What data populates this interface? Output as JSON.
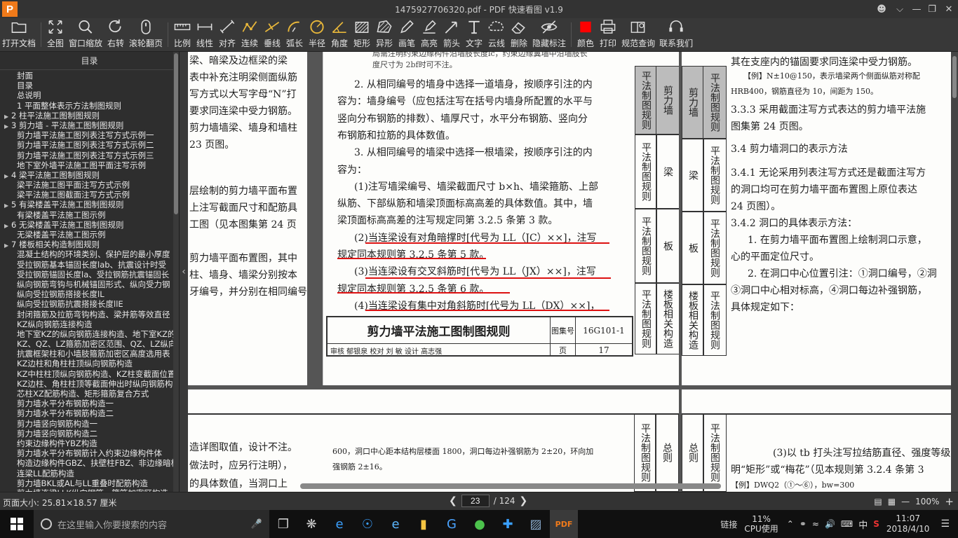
{
  "window": {
    "title": "1475927706320.pdf - PDF 快速看图 v1.9",
    "logo": "P"
  },
  "toolbar": [
    {
      "label": "打开文档",
      "icon": "folder-icon"
    },
    {
      "label": "全图",
      "icon": "fit-all-icon"
    },
    {
      "label": "窗口缩放",
      "icon": "zoom-window-icon"
    },
    {
      "label": "右转",
      "icon": "rotate-right-icon"
    },
    {
      "label": "滚轮翻页",
      "icon": "mouse-wheel-icon"
    },
    {
      "label": "比例",
      "icon": "ruler-icon"
    },
    {
      "label": "线性",
      "icon": "linear-measure-icon"
    },
    {
      "label": "对齐",
      "icon": "aligned-measure-icon"
    },
    {
      "label": "连续",
      "icon": "continuous-measure-icon"
    },
    {
      "label": "垂线",
      "icon": "perpendicular-icon"
    },
    {
      "label": "弧长",
      "icon": "arc-length-icon"
    },
    {
      "label": "半径",
      "icon": "radius-icon"
    },
    {
      "label": "角度",
      "icon": "angle-icon"
    },
    {
      "label": "矩形",
      "icon": "rectangle-area-icon"
    },
    {
      "label": "异形",
      "icon": "irregular-area-icon"
    },
    {
      "label": "画笔",
      "icon": "pen-icon"
    },
    {
      "label": "高亮",
      "icon": "highlight-icon"
    },
    {
      "label": "箭头",
      "icon": "arrow-icon"
    },
    {
      "label": "文字",
      "icon": "text-icon"
    },
    {
      "label": "云线",
      "icon": "cloud-line-icon"
    },
    {
      "label": "删除",
      "icon": "eraser-icon"
    },
    {
      "label": "隐藏标注",
      "icon": "hide-annotation-icon"
    },
    {
      "label": "颜色",
      "icon": "color-swatch-icon"
    },
    {
      "label": "打印",
      "icon": "printer-icon"
    },
    {
      "label": "规范查询",
      "icon": "book-search-icon"
    },
    {
      "label": "联系我们",
      "icon": "headset-icon"
    }
  ],
  "colors": {
    "accent": "#e8b73a",
    "swatch": "#ff0000",
    "annotation": "#d11111",
    "logo": "#f07a1a"
  },
  "outline": {
    "header": "目录",
    "items": [
      {
        "label": "封面",
        "level": 0,
        "toggle": ""
      },
      {
        "label": "目录",
        "level": 0,
        "toggle": ""
      },
      {
        "label": "总说明",
        "level": 0,
        "toggle": ""
      },
      {
        "label": "1 平面整体表示方法制图规则",
        "level": 0,
        "toggle": ""
      },
      {
        "label": "2 柱平法施工图制图规则",
        "level": 0,
        "toggle": "▶"
      },
      {
        "label": "3 剪力墙 - 平法施工图制图规则",
        "level": 0,
        "toggle": "▶"
      },
      {
        "label": "剪力墙平法施工图列表注写方式示例一",
        "level": 1,
        "toggle": ""
      },
      {
        "label": "剪力墙平法施工图列表注写方式示例二",
        "level": 1,
        "toggle": ""
      },
      {
        "label": "剪力墙平法施工图列表注写方式示例三",
        "level": 1,
        "toggle": ""
      },
      {
        "label": "地下室外墙平法施工图平面注写示例",
        "level": 1,
        "toggle": ""
      },
      {
        "label": "4 梁平法施工图制图规则",
        "level": 0,
        "toggle": "▶"
      },
      {
        "label": "梁平法施工图平面注写方式示例",
        "level": 1,
        "toggle": ""
      },
      {
        "label": "梁平法施工图截面注写方式示例",
        "level": 1,
        "toggle": ""
      },
      {
        "label": "5 有梁楼盖平法施工图制图规则",
        "level": 0,
        "toggle": "▶"
      },
      {
        "label": "有梁楼盖平法施工图示例",
        "level": 1,
        "toggle": ""
      },
      {
        "label": "6 无梁楼盖平法施工图制图规则",
        "level": 0,
        "toggle": "▶"
      },
      {
        "label": "无梁楼盖平法施工图示例",
        "level": 1,
        "toggle": ""
      },
      {
        "label": "7 楼板相关构造制图规则",
        "level": 0,
        "toggle": "▶"
      },
      {
        "label": "混凝土结构的环境类别、保护层的最小厚度",
        "level": 0,
        "toggle": ""
      },
      {
        "label": "受拉钢筋基本锚固长度lab、抗震设计时受",
        "level": 0,
        "toggle": ""
      },
      {
        "label": "受拉钢筋锚固长度la、受拉钢筋抗震锚固长",
        "level": 0,
        "toggle": ""
      },
      {
        "label": "纵向钢筋弯钩与机械锚固形式、纵向受力钢",
        "level": 0,
        "toggle": ""
      },
      {
        "label": "纵向受拉钢筋搭接长度lL",
        "level": 0,
        "toggle": ""
      },
      {
        "label": "纵向受拉钢筋抗震搭接长度llE",
        "level": 0,
        "toggle": ""
      },
      {
        "label": "封闭箍筋及拉筋弯钩构造、梁并筋等效直径",
        "level": 0,
        "toggle": ""
      },
      {
        "label": "KZ纵向钢筋连接构造",
        "level": 0,
        "toggle": ""
      },
      {
        "label": "地下室KZ的纵向钢筋连接构造、地下室KZ的",
        "level": 0,
        "toggle": ""
      },
      {
        "label": "KZ、QZ、LZ箍筋加密区范围、QZ、LZ纵向钢",
        "level": 0,
        "toggle": ""
      },
      {
        "label": "抗震框架柱和小墙肢箍筋加密区高度选用表",
        "level": 0,
        "toggle": ""
      },
      {
        "label": "KZ边柱和角柱柱顶纵向钢筋构造",
        "level": 0,
        "toggle": ""
      },
      {
        "label": "KZ中柱柱顶纵向钢筋构造、KZ柱变截面位置",
        "level": 0,
        "toggle": ""
      },
      {
        "label": "KZ边柱、角柱柱顶等截面伸出时纵向钢筋构",
        "level": 0,
        "toggle": ""
      },
      {
        "label": "芯柱XZ配筋构造、矩形箍筋复合方式",
        "level": 0,
        "toggle": ""
      },
      {
        "label": "剪力墙水平分布钢筋构造一",
        "level": 0,
        "toggle": ""
      },
      {
        "label": "剪力墙水平分布钢筋构造二",
        "level": 0,
        "toggle": ""
      },
      {
        "label": "剪力墙竖向钢筋构造一",
        "level": 0,
        "toggle": ""
      },
      {
        "label": "剪力墙竖向钢筋构造二",
        "level": 0,
        "toggle": ""
      },
      {
        "label": "约束边缘构件YBZ构造",
        "level": 0,
        "toggle": ""
      },
      {
        "label": "剪力墙水平分布钢筋计入约束边缘构件体",
        "level": 0,
        "toggle": ""
      },
      {
        "label": "构造边缘构件GBZ、扶壁柱FBZ、非边缘暗柱",
        "level": 0,
        "toggle": ""
      },
      {
        "label": "连梁LL配筋构造",
        "level": 0,
        "toggle": ""
      },
      {
        "label": "剪力墙BKL或AL与LL重叠时配筋构造",
        "level": 0,
        "toggle": ""
      },
      {
        "label": "剪力墙连梁LLK纵向钢筋、箍筋加密区构造",
        "level": 0,
        "toggle": ""
      }
    ]
  },
  "page_left": {
    "lines": [
      "梁、暗梁及边框梁的梁",
      "表中补充注明梁侧面纵筋",
      "写方式以大写字母“N”打",
      "要求同连梁中受力钢筋。",
      "剪力墙墙梁、墙身和墙柱",
      "23 页图。",
      "层绘制的剪力墙平面布置",
      "上注写截面尺寸和配筋具",
      "工图（见本图集第 24 页",
      "剪力墙平面布置图，其中",
      "柱、墙身、墙梁分别按本",
      "牙编号，并分别在相同编号"
    ]
  },
  "page_main": {
    "top_note_1": "局需注明约束边缘构件沿墙肢长度lc，约束边缘翼墙中沿墙肢长",
    "top_note_2": "度尺寸为 2bf时可不注。",
    "lines": [
      "2. 从相同编号的墙身中选择一道墙身，按顺序引注的内",
      "容为：墙身编号（应包括注写在括号内墙身所配置的水平与",
      "竖向分布钢筋的排数）、墙厚尺寸，水平分布钢筋、竖向分",
      "布钢筋和拉筋的具体数值。",
      "3. 从相同编号的墙梁中选择一根墙梁，按顺序引注的内",
      "容为：",
      "(1)注写墙梁编号、墙梁截面尺寸 b×h、墙梁箍筋、上部",
      "纵筋、下部纵筋和墙梁顶面标高高差的具体数值。其中，墙",
      "梁顶面标高高差的注写规定同第 3.2.5 条第 3 款。",
      "(2)当连梁设有对角暗撑时[代号为 LL（JC）××]，注写",
      "规定同本规则第 3.2.5 条第 5 款。",
      "(3)当连梁设有交叉斜筋时[代号为 LL（JX）××]，注写",
      "规定同本规则第 3.2.5 条第 6 款。",
      "(4)当连梁设有集中对角斜筋时[代号为 LL（DX）××]，"
    ],
    "title_block": {
      "title": "剪力墙平法施工图制图规则",
      "atlas_label": "图集号",
      "atlas_no": "16G101-1",
      "row2": "审核 郁银泉 校对 刘 敏 设计 高志强",
      "page_label": "页",
      "page_no": "17"
    },
    "side_tabs": [
      "剪力墙",
      "平法制图规则",
      "梁",
      "平法制图规则",
      "板",
      "平法制图规则",
      "楼板相关构造",
      "平法制图规则"
    ]
  },
  "page_right": {
    "lines": [
      "其在支座内的锚固要求同连梁中受力钢筋。",
      "【例】N±10@150，表示墙梁两个侧面纵筋对称配",
      "HRB400，钢筋直径为 10，间距为 150。",
      "3.3.3 采用截面注写方式表达的剪力墙平法施",
      "图集第 24 页图。",
      "3.4 剪力墙洞口的表示方法",
      "3.4.1 无论采用列表注写方式还是截面注写方",
      "的洞口均可在剪力墙平面布置图上原位表达",
      "24 页图）。",
      "3.4.2 洞口的具体表示方法：",
      "1. 在剪力墙平面布置图上绘制洞口示意，",
      "心的平面定位尺寸。",
      "2. 在洞口中心位置引注：①洞口编号，②洞",
      "③洞口中心相对标高，④洞口每边补强钢筋，",
      "具体规定如下："
    ],
    "side_tabs": [
      "剪力墙",
      "平法制图规则",
      "梁",
      "平法制图规则",
      "板",
      "平法制图规则",
      "楼板相关构造",
      "平法制图规则"
    ]
  },
  "page_bottom": {
    "left_lines": [
      "造详图取值，设计不注。",
      "做法时，应另行注明），",
      "的具体数值，当洞口上"
    ],
    "mid_lines": [
      "600，洞口中心距本结构层楼面 1800，洞口每边补强钢筋为 2±20，环向加",
      "强钢筋 2±16。"
    ],
    "tab_mid": [
      "平法制图规则",
      "总则"
    ],
    "tab_right": [
      "总则",
      "平法制图规则"
    ],
    "right_lines": [
      "(3)以 tb 打头注写拉结筋直径、强度等级",
      "明“矩形”或“梅花”（见本规则第 3.2.4 条第 3",
      "【例】DWQ2（①～⑥），bw=300"
    ]
  },
  "status": {
    "page_size": "页面大小: 25.81×18.57 厘米",
    "current_page": "23",
    "total_pages": "/ 124",
    "zoom": "100%"
  },
  "taskbar": {
    "search_placeholder": "在这里输入你要搜索的内容",
    "links": "链接",
    "cpu_percent": "11%",
    "cpu_label": "CPU使用",
    "ime": "中",
    "time": "11:07",
    "date": "2018/4/10"
  }
}
